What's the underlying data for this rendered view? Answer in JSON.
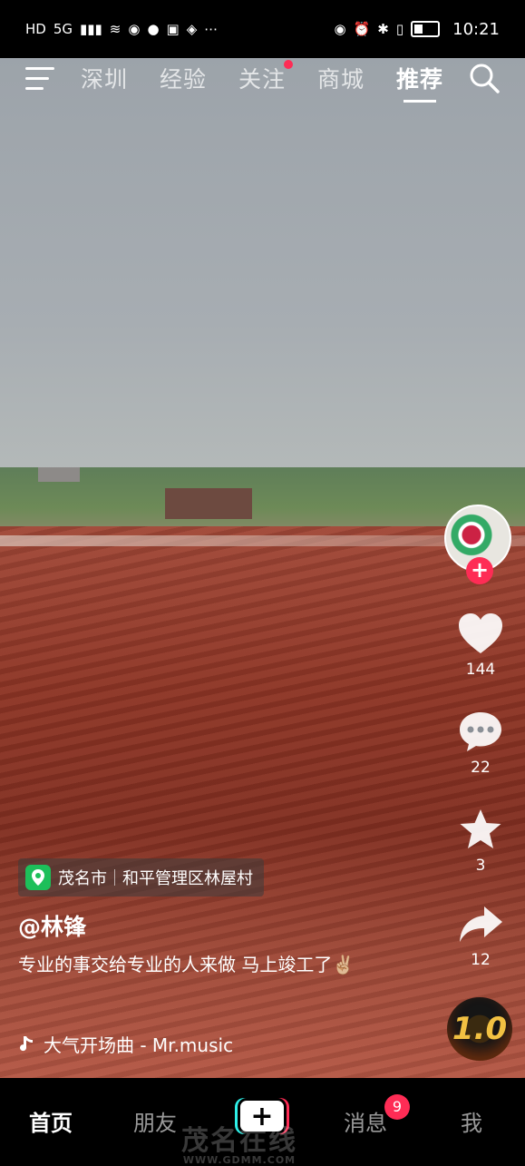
{
  "status_bar": {
    "left_indicators": [
      "HD",
      "5G"
    ],
    "time": "10:21"
  },
  "top_nav": {
    "tabs": [
      {
        "label": "深圳"
      },
      {
        "label": "经验"
      },
      {
        "label": "关注",
        "has_dot": true
      },
      {
        "label": "商城"
      },
      {
        "label": "推荐",
        "active": true
      }
    ]
  },
  "sidebar": {
    "like_count": "144",
    "comment_count": "22",
    "favorite_count": "3",
    "share_count": "12",
    "disc_label": "1.0"
  },
  "video_info": {
    "location_city": "茂名市",
    "location_detail": "和平管理区林屋村",
    "author": "@林锋",
    "caption": "专业的事交给专业的人来做 马上竣工了✌🏼",
    "music": "大气开场曲 - Mr.music"
  },
  "bottom_tabs": {
    "home": "首页",
    "friends": "朋友",
    "create": "+",
    "messages": "消息",
    "messages_badge": "9",
    "me": "我"
  },
  "watermark": {
    "text": "茂名在线",
    "url": "WWW.GDMM.COM"
  },
  "colors": {
    "accent_red": "#fe2c55",
    "accent_cyan": "#2ef0e8",
    "location_green": "#1dbf5a"
  }
}
